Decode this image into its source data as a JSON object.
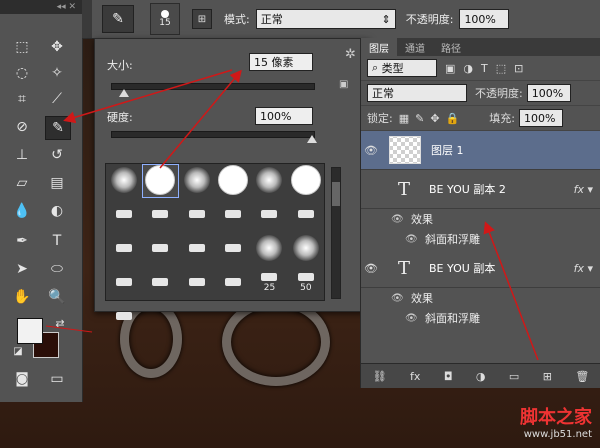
{
  "options_bar": {
    "brush_size": "15",
    "mode_label": "模式:",
    "mode_value": "正常",
    "opacity_label": "不透明度:",
    "opacity_value": "100%"
  },
  "brush_popup": {
    "size_label": "大小:",
    "size_value": "15 像素",
    "hardness_label": "硬度:",
    "hardness_value": "100%",
    "presets": [
      "",
      "",
      "",
      "",
      "",
      "",
      "",
      "",
      "",
      "",
      "",
      "",
      "",
      "",
      "",
      "",
      "",
      "",
      "",
      "",
      "",
      "",
      "25",
      "50",
      ""
    ]
  },
  "layers_panel": {
    "tabs": [
      "图层",
      "通道",
      "路径"
    ],
    "kind_filter": "类型",
    "blend_mode": "正常",
    "opacity_label": "不透明度:",
    "opacity_value": "100%",
    "lock_label": "锁定:",
    "fill_label": "填充:",
    "fill_value": "100%",
    "layers": [
      {
        "name": "图层 1",
        "type": "pixel"
      },
      {
        "name": "BE    YOU 副本 2",
        "type": "text",
        "effects_label": "效果",
        "effects": [
          "斜面和浮雕"
        ]
      },
      {
        "name": "BE    YOU 副本",
        "type": "text",
        "effects_label": "效果",
        "effects": [
          "斜面和浮雕"
        ]
      }
    ]
  },
  "watermark": {
    "brand": "脚本之家",
    "url": "www.jb51.net"
  },
  "colors": {
    "foreground": "#f2f2f2",
    "background": "#2a0e08",
    "arrow": "#d01818"
  }
}
